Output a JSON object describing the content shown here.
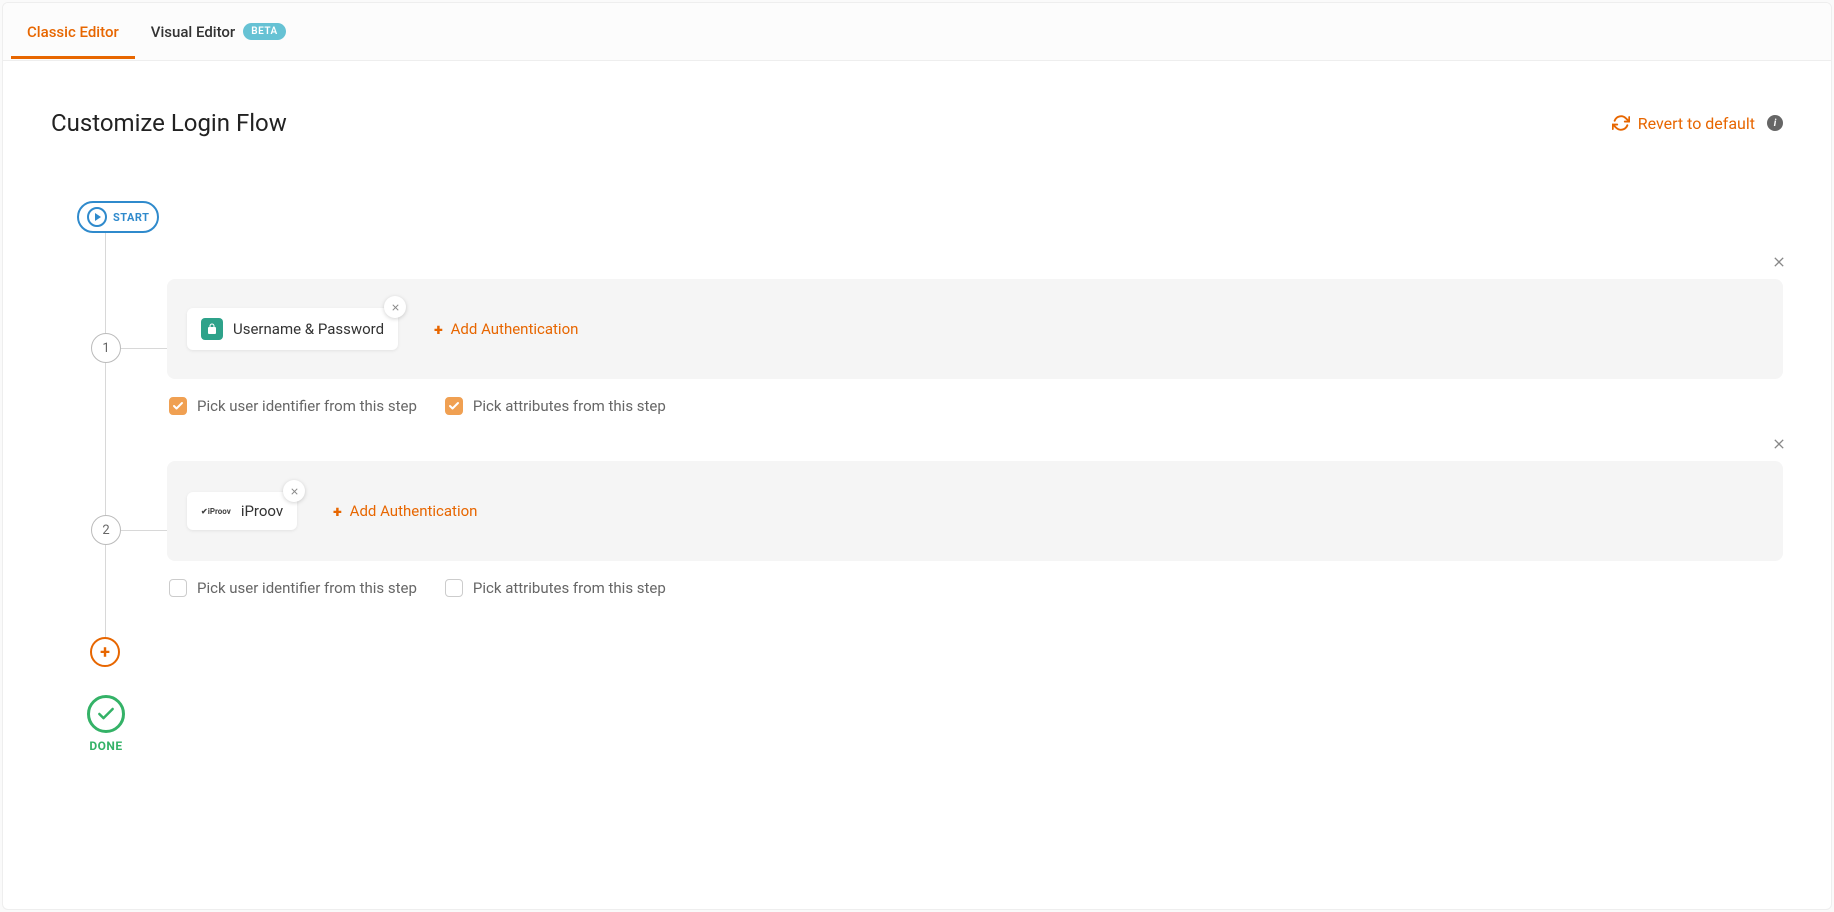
{
  "tabs": {
    "classic": "Classic Editor",
    "visual": "Visual Editor",
    "beta_badge": "BETA"
  },
  "header": {
    "title": "Customize Login Flow",
    "revert": "Revert to default"
  },
  "flow": {
    "start_label": "START",
    "done_label": "DONE",
    "add_auth_label": "Add Authentication",
    "steps": [
      {
        "number": "1",
        "authenticators": [
          {
            "name": "Username & Password",
            "icon": "lock"
          }
        ],
        "pick_identifier": {
          "label": "Pick user identifier from this step",
          "checked": true
        },
        "pick_attributes": {
          "label": "Pick attributes from this step",
          "checked": true
        }
      },
      {
        "number": "2",
        "authenticators": [
          {
            "name": "iProov",
            "icon": "iproov"
          }
        ],
        "pick_identifier": {
          "label": "Pick user identifier from this step",
          "checked": false
        },
        "pick_attributes": {
          "label": "Pick attributes from this step",
          "checked": false
        }
      }
    ]
  }
}
